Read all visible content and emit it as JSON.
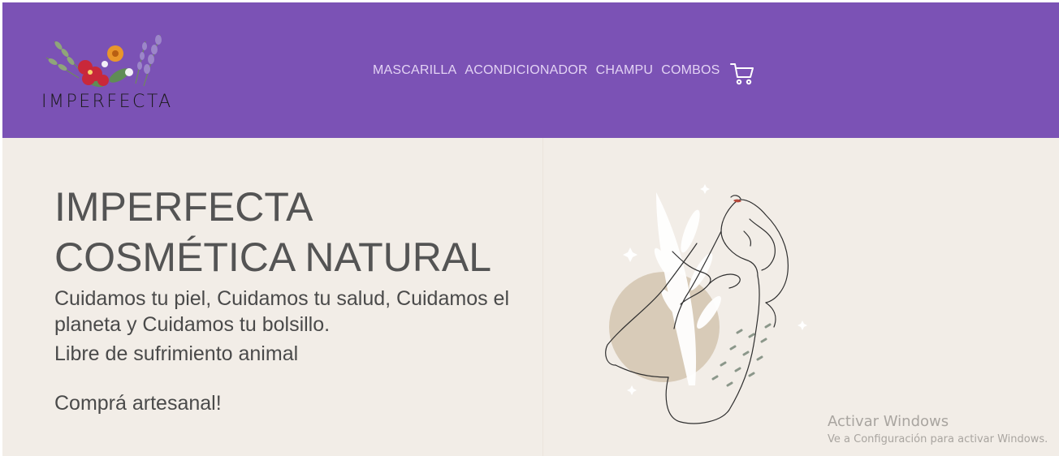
{
  "brand": {
    "logo_text": "IMPERFECTA"
  },
  "nav": {
    "items": [
      {
        "label": "MASCARILLA"
      },
      {
        "label": "ACONDICIONADOR"
      },
      {
        "label": "CHAMPU"
      },
      {
        "label": "COMBOS"
      }
    ],
    "cart_icon": "shopping-cart-icon"
  },
  "hero": {
    "title_line1": "IMPERFECTA",
    "title_line2": "COSMÉTICA NATURAL",
    "tagline": "Cuidamos tu piel, Cuidamos tu salud, Cuidamos el planeta y Cuidamos tu bolsillo.",
    "cruelty_free": "Libre de sufrimiento animal",
    "buy_artisanal": "Comprá artesanal!"
  },
  "watermark": {
    "title": "Activar Windows",
    "subtitle": "Ve a Configuración para activar Windows."
  },
  "colors": {
    "header_bg": "#7b52b5",
    "hero_bg": "#f2ede7",
    "accent_gold": "#d9a85b",
    "accent_beige": "#d8cbb8"
  }
}
